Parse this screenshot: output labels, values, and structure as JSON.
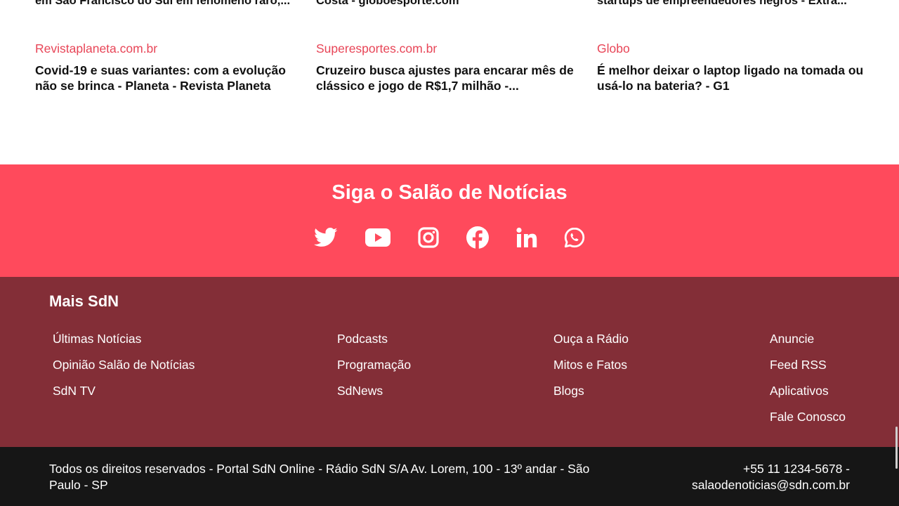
{
  "news": [
    {
      "truncated_title": "em São Francisco do Sul em fenômeno raro,...",
      "source": "Revistaplaneta.com.br",
      "headline": "Covid-19 e suas variantes: com a evolução não se brinca - Planeta - Revista Planeta"
    },
    {
      "truncated_title": "Costa - globoesporte.com",
      "source": "Superesportes.com.br",
      "headline": "Cruzeiro busca ajustes para encarar mês de clássico e jogo de R$1,7 milhão -..."
    },
    {
      "truncated_title": "startups de empreendedores negros - Extra...",
      "source": "Globo",
      "headline": "É melhor deixar o laptop ligado na tomada ou usá-lo na bateria? - G1"
    }
  ],
  "follow": {
    "title": "Siga o Salão de Notícias",
    "icons": [
      "twitter-icon",
      "youtube-icon",
      "instagram-icon",
      "facebook-icon",
      "linkedin-icon",
      "whatsapp-icon"
    ]
  },
  "more": {
    "title": "Mais SdN",
    "columns": [
      [
        "Últimas Notícias",
        "Opinião Salão de Notícias",
        "SdN TV"
      ],
      [
        "Podcasts",
        "Programação",
        "SdNews"
      ],
      [
        "Ouça a Rádio",
        "Mitos e Fatos",
        "Blogs"
      ],
      [
        "Anuncie",
        "Feed RSS",
        "Aplicativos",
        "Fale Conosco"
      ]
    ]
  },
  "bottom": {
    "address": "Todos os direitos reservados - Portal SdN Online - Rádio SdN S/A Av. Lorem, 100 - 13º andar - São Paulo - SP",
    "contact": "+55 11 1234-5678 - salaodenoticias@sdn.com.br"
  },
  "colors": {
    "accent": "#ff4a5c",
    "source_text": "#e84557",
    "footer_bg": "#832e37",
    "bottom_bg": "#161616"
  }
}
